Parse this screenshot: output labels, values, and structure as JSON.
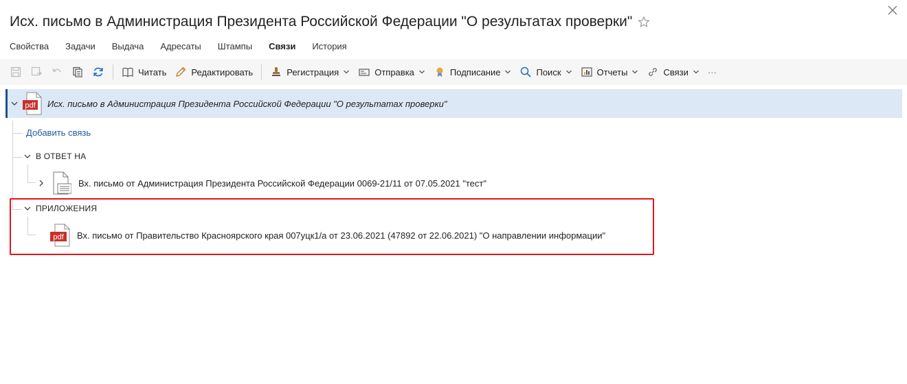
{
  "window": {
    "title": "Исх. письмо в Администрация Президента Российской Федерации \"О результатах проверки\""
  },
  "tabs": [
    {
      "label": "Свойства"
    },
    {
      "label": "Задачи"
    },
    {
      "label": "Выдача"
    },
    {
      "label": "Адресаты"
    },
    {
      "label": "Штампы"
    },
    {
      "label": "Связи"
    },
    {
      "label": "История"
    }
  ],
  "active_tab": "Связи",
  "toolbar": {
    "read": "Читать",
    "edit": "Редактировать",
    "registration": "Регистрация",
    "sending": "Отправка",
    "signing": "Подписание",
    "search": "Поиск",
    "reports": "Отчеты",
    "links": "Связи",
    "more": "···"
  },
  "tree": {
    "root": {
      "title": "Исх. письмо в Администрация Президента Российской Федерации \"О результатах проверки\"",
      "icon": "pdf-icon"
    },
    "add_link": "Добавить связь",
    "groups": [
      {
        "label": "В ОТВЕТ НА",
        "items": [
          {
            "title": "Вх. письмо от Администрация Президента Российской Федерации 0069-21/11 от 07.05.2021 \"тест\"",
            "icon": "document-icon"
          }
        ]
      },
      {
        "label": "ПРИЛОЖЕНИЯ",
        "items": [
          {
            "title": "Вх. письмо от Правительство Красноярского края 007уцк1/а от 23.06.2021 (47892 от 22.06.2021) \"О направлении информации\"",
            "icon": "pdf-icon"
          }
        ]
      }
    ]
  },
  "colors": {
    "accent": "#1f4f8f",
    "selection": "#dce8f5",
    "link": "#1f5aa3",
    "highlight": "#e0151b",
    "pdf": "#c9302c"
  }
}
